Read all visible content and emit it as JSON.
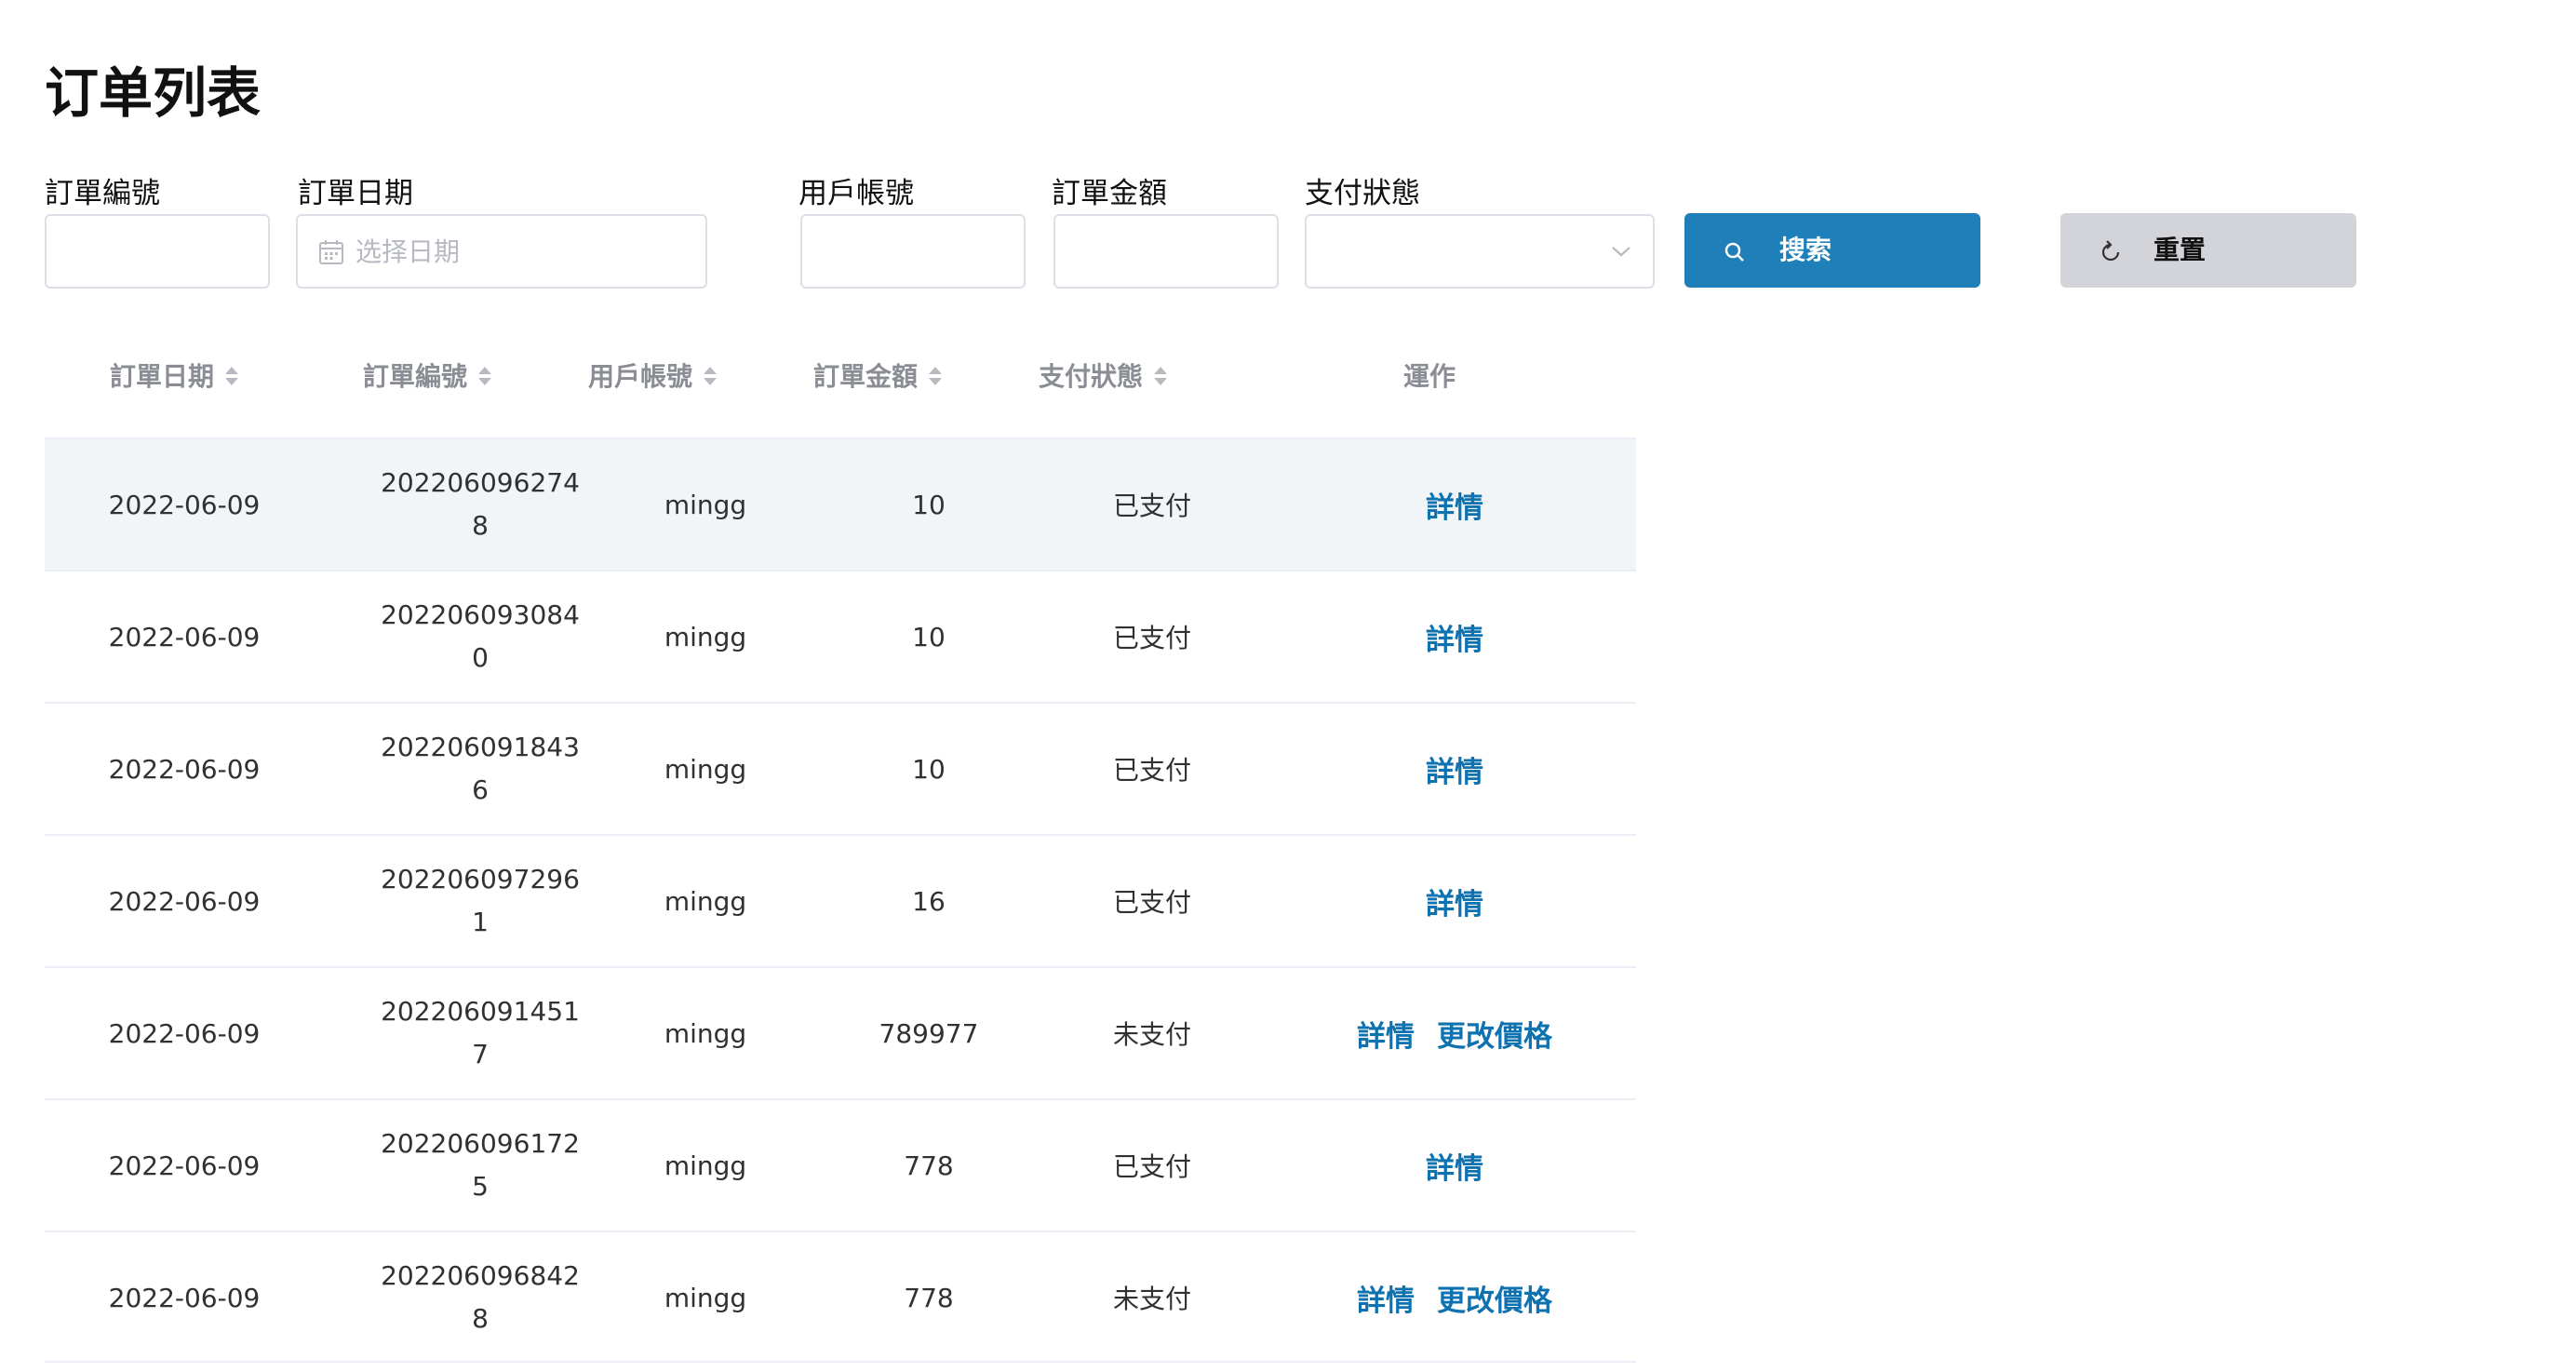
{
  "page": {
    "title": "订单列表"
  },
  "filters": {
    "order_no": {
      "label": "訂單編號",
      "value": ""
    },
    "order_date": {
      "label": "訂單日期",
      "placeholder": "选择日期",
      "value": ""
    },
    "account": {
      "label": "用戶帳號",
      "value": ""
    },
    "amount": {
      "label": "訂單金額",
      "value": ""
    },
    "pay_status": {
      "label": "支付狀態",
      "selected": ""
    },
    "search_label": "搜索",
    "reset_label": "重置"
  },
  "table": {
    "columns": [
      {
        "label": "訂單日期",
        "sortable": true
      },
      {
        "label": "訂單編號",
        "sortable": true
      },
      {
        "label": "用戶帳號",
        "sortable": true
      },
      {
        "label": "訂單金額",
        "sortable": true
      },
      {
        "label": "支付狀態",
        "sortable": true
      },
      {
        "label": "運作",
        "sortable": false
      }
    ],
    "rows": [
      {
        "date": "2022-06-09",
        "no_line1": "202206096274",
        "no_line2": "8",
        "account": "mingg",
        "amount": "10",
        "status": "已支付",
        "actions": [
          "詳情"
        ]
      },
      {
        "date": "2022-06-09",
        "no_line1": "202206093084",
        "no_line2": "0",
        "account": "mingg",
        "amount": "10",
        "status": "已支付",
        "actions": [
          "詳情"
        ]
      },
      {
        "date": "2022-06-09",
        "no_line1": "202206091843",
        "no_line2": "6",
        "account": "mingg",
        "amount": "10",
        "status": "已支付",
        "actions": [
          "詳情"
        ]
      },
      {
        "date": "2022-06-09",
        "no_line1": "202206097296",
        "no_line2": "1",
        "account": "mingg",
        "amount": "16",
        "status": "已支付",
        "actions": [
          "詳情"
        ]
      },
      {
        "date": "2022-06-09",
        "no_line1": "202206091451",
        "no_line2": "7",
        "account": "mingg",
        "amount": "789977",
        "status": "未支付",
        "actions": [
          "詳情",
          "更改價格"
        ]
      },
      {
        "date": "2022-06-09",
        "no_line1": "202206096172",
        "no_line2": "5",
        "account": "mingg",
        "amount": "778",
        "status": "已支付",
        "actions": [
          "詳情"
        ]
      },
      {
        "date": "2022-06-09",
        "no_line1": "202206096842",
        "no_line2": "8",
        "account": "mingg",
        "amount": "778",
        "status": "未支付",
        "actions": [
          "詳情",
          "更改價格"
        ]
      }
    ]
  },
  "colors": {
    "primary": "#1f7fb8",
    "link": "#0f72b0",
    "reset_bg": "#d2d4d9",
    "row_hover": "#f2f5f8",
    "border": "#dcdfe6",
    "header_text": "#8a8d93"
  },
  "icons": {
    "calendar": "calendar-icon",
    "chevron": "chevron-down-icon",
    "search": "search-icon",
    "reset": "refresh-icon",
    "sort": "sort-caret-icon"
  }
}
